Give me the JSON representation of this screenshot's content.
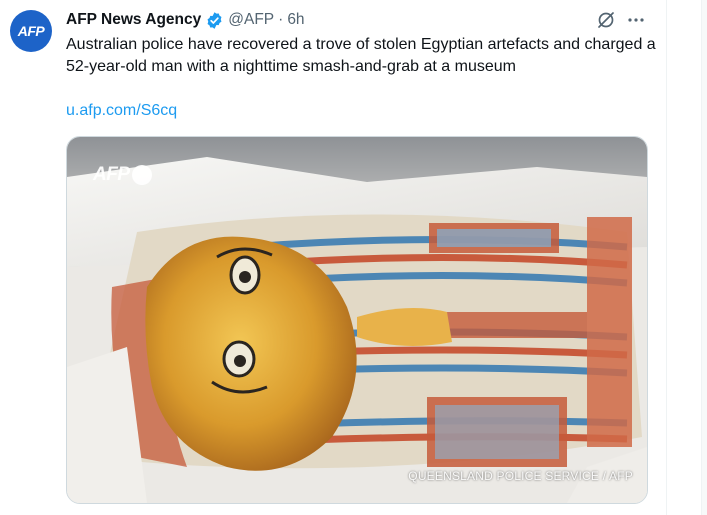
{
  "author": {
    "avatar_text": "AFP",
    "name": "AFP News Agency",
    "handle": "@AFP",
    "separator": "·",
    "time": "6h"
  },
  "tweet": {
    "text": "Australian police have recovered a trove of stolen Egyptian artefacts and charged a 52-year-old man with a nighttime smash-and-grab at a museum",
    "link": "u.afp.com/S6cq"
  },
  "media": {
    "watermark": "AFP",
    "credit": "QUEENSLAND POLICE SERVICE / AFP"
  },
  "icons": {
    "verified": "verified-badge-icon",
    "grok": "grok-icon",
    "more": "more-options-icon"
  },
  "colors": {
    "brand_blue": "#1d63c8",
    "link_blue": "#1d9bf0",
    "verified_blue": "#1d9bf0",
    "secondary_text": "#536471"
  }
}
